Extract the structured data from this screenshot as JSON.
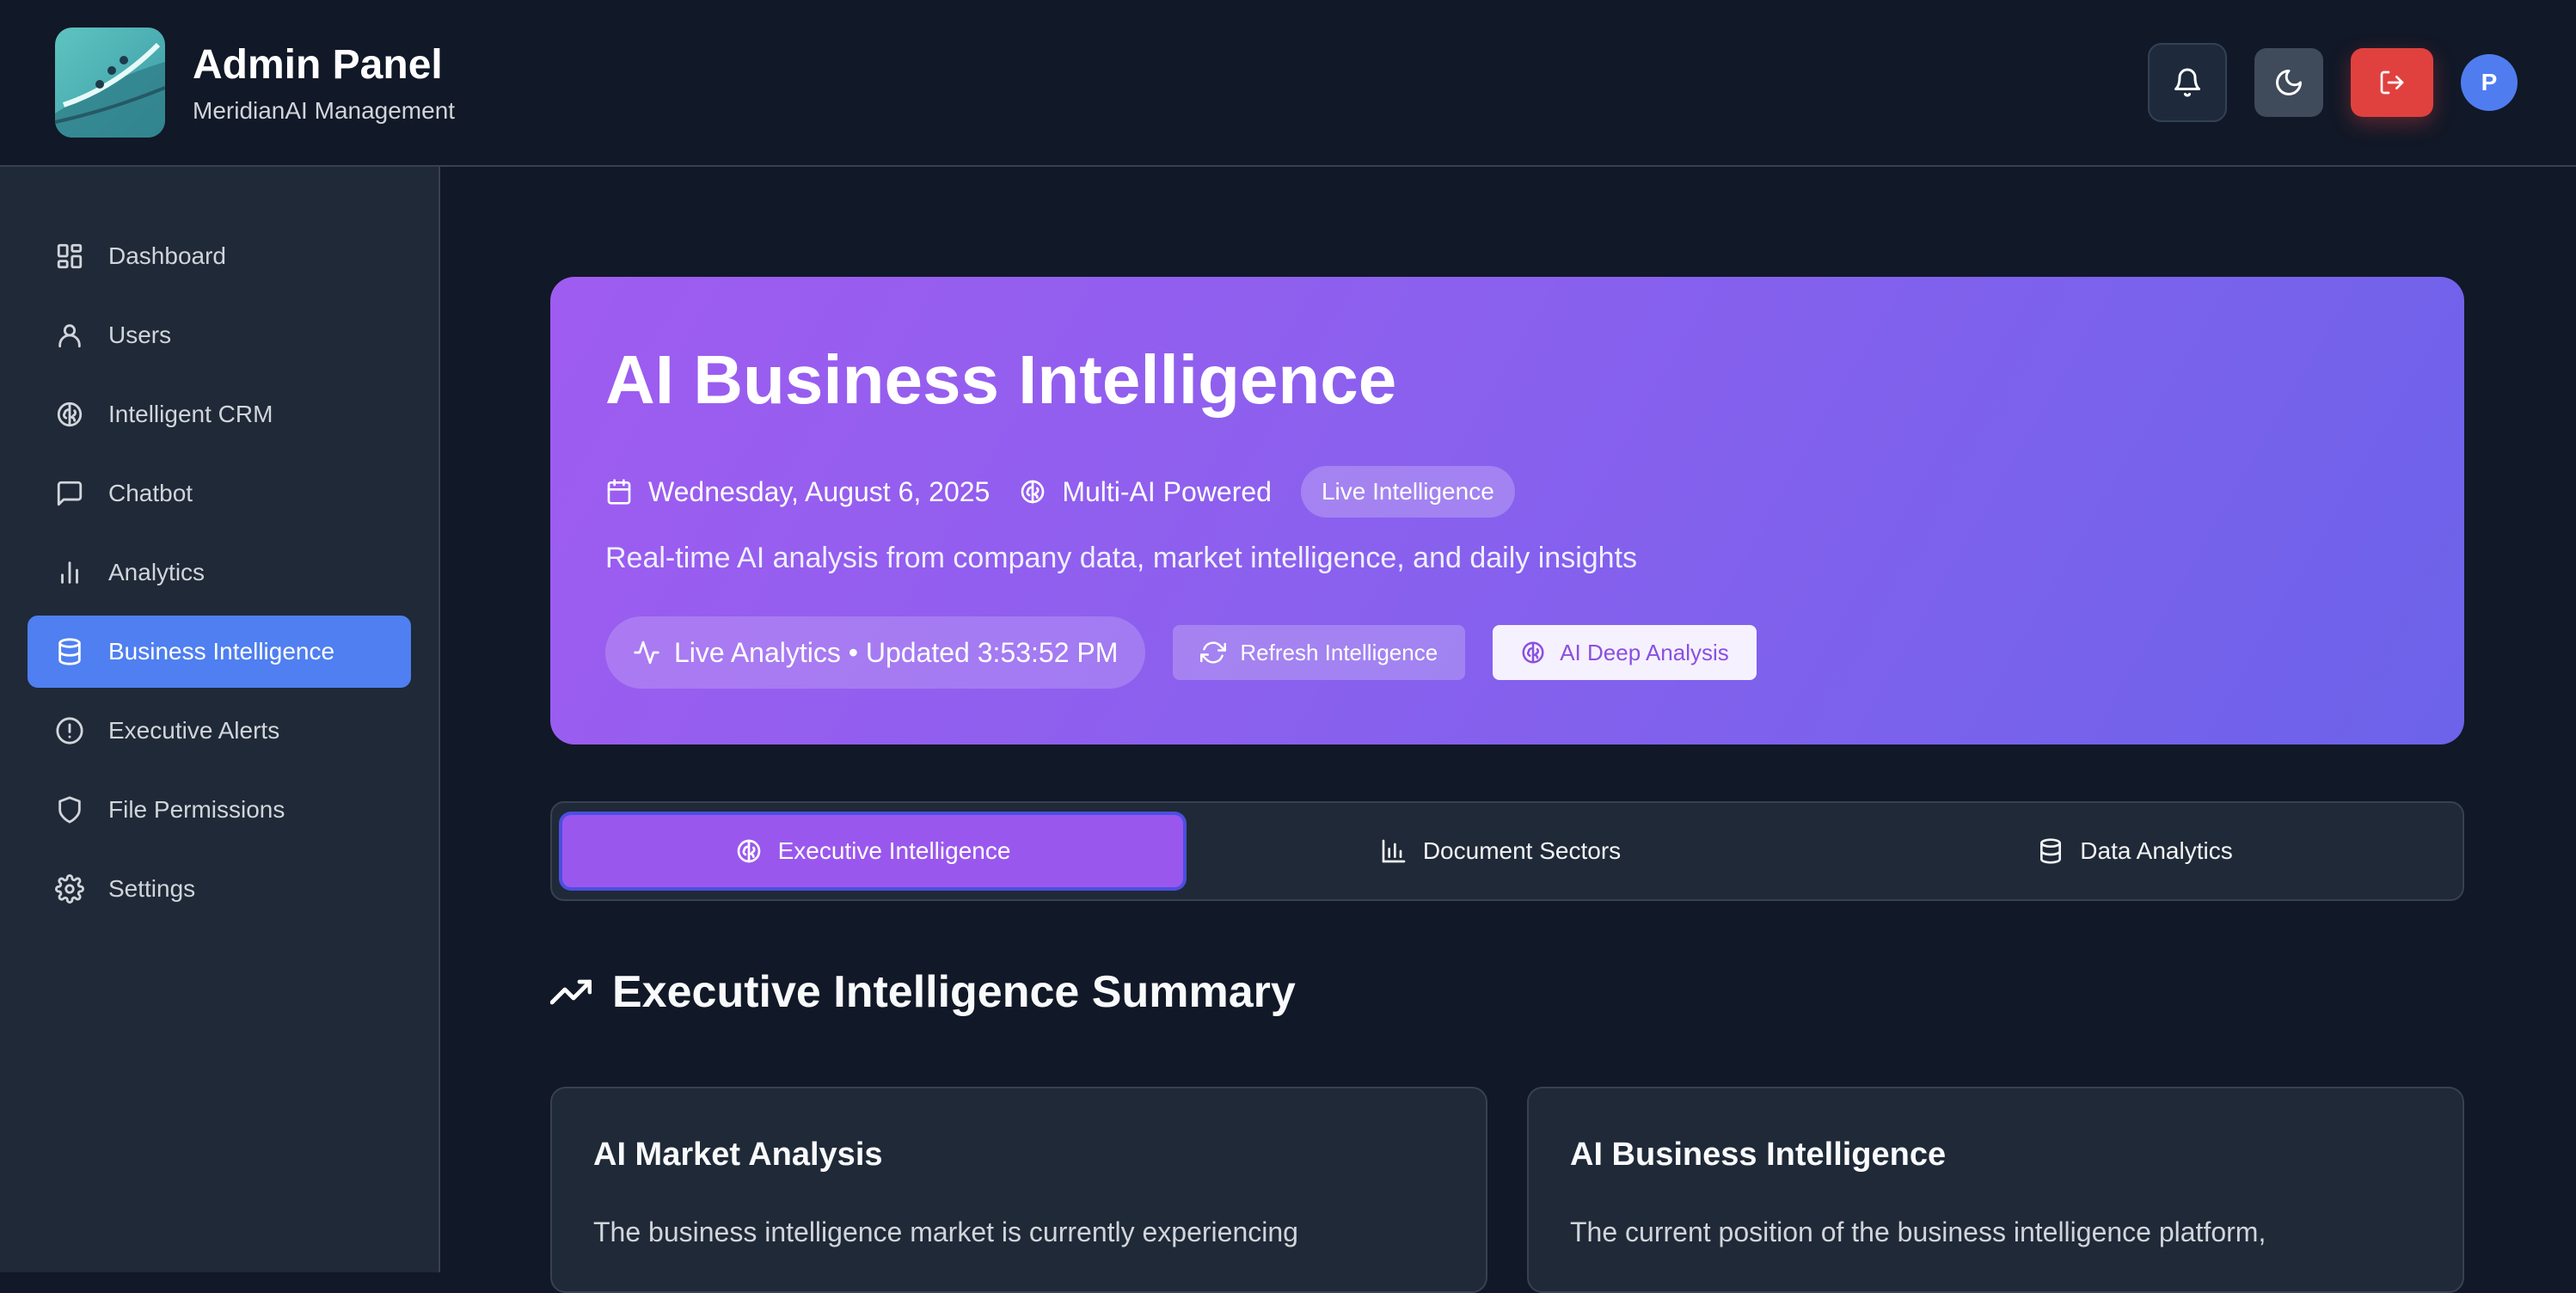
{
  "header": {
    "title": "Admin Panel",
    "subtitle": "MeridianAI Management",
    "actions": {
      "notifications_icon": "bell-icon",
      "theme_icon": "moon-icon",
      "logout_icon": "logout-icon",
      "avatar_initial": "P"
    }
  },
  "sidebar": {
    "items": [
      {
        "label": "Dashboard",
        "icon": "dashboard-icon"
      },
      {
        "label": "Users",
        "icon": "user-icon"
      },
      {
        "label": "Intelligent CRM",
        "icon": "brain-icon"
      },
      {
        "label": "Chatbot",
        "icon": "chat-icon"
      },
      {
        "label": "Analytics",
        "icon": "bar-chart-icon"
      },
      {
        "label": "Business Intelligence",
        "icon": "database-icon",
        "active": true
      },
      {
        "label": "Executive Alerts",
        "icon": "alert-circle-icon"
      },
      {
        "label": "File Permissions",
        "icon": "shield-icon"
      },
      {
        "label": "Settings",
        "icon": "gear-icon"
      }
    ]
  },
  "hero": {
    "title": "AI Business Intelligence",
    "date": "Wednesday, August 6, 2025",
    "powered": "Multi-AI Powered",
    "live_badge": "Live Intelligence",
    "description": "Real-time AI analysis from company data, market intelligence, and daily insights",
    "status": "Live Analytics • Updated 3:53:52 PM",
    "refresh_label": "Refresh Intelligence",
    "deep_label": "AI Deep Analysis"
  },
  "tabs": [
    {
      "label": "Executive Intelligence",
      "icon": "brain-icon",
      "active": true
    },
    {
      "label": "Document Sectors",
      "icon": "bar-chart-icon"
    },
    {
      "label": "Data Analytics",
      "icon": "database-icon"
    }
  ],
  "section": {
    "title": "Executive Intelligence Summary",
    "icon": "trending-up-icon"
  },
  "cards": [
    {
      "title": "AI Market Analysis",
      "body": "The business intelligence market is currently experiencing"
    },
    {
      "title": "AI Business Intelligence",
      "body": "The current position of the business intelligence platform,"
    }
  ],
  "colors": {
    "accent": "#4f7ff0",
    "hero_start": "#9f5cf0",
    "hero_end": "#6c63ea",
    "logout": "#e0413f"
  }
}
